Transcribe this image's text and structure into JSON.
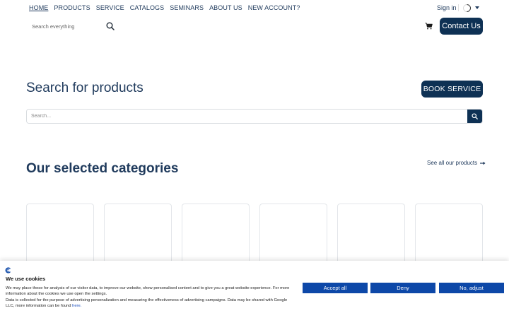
{
  "nav": {
    "items": [
      {
        "label": "HOME",
        "active": true
      },
      {
        "label": "PRODUCTS"
      },
      {
        "label": "SERVICE"
      },
      {
        "label": "CATALOGS"
      },
      {
        "label": "SEMINARS"
      },
      {
        "label": "ABOUT US"
      },
      {
        "label": "NEW ACCOUNT?"
      }
    ],
    "signin": "Sign in"
  },
  "header": {
    "search_placeholder": "Search everything",
    "contact_label": "Contact Us",
    "search_icon": "search-icon",
    "cart_icon": "cart-icon"
  },
  "search_section": {
    "heading": "Search for products",
    "book_label": "BOOK SERVICE",
    "placeholder": "Search..."
  },
  "categories": {
    "heading": "Our selected categories",
    "see_all": "See all our products"
  },
  "cookie": {
    "title": "We use cookies",
    "text_1": "We may place these for analysis of our visitor data, to improve our website, show personalised content and to give you a great website experience. For more information about the cookies we use open the settings.",
    "text_2": "Data is collected for the purpose of advertising personalization and measuring the effectiveness of advertising campaigns. Data may be shared with Google LLC, more information can be found",
    "link": "here.",
    "accept": "Accept all",
    "deny": "Deny",
    "adjust": "No, adjust"
  },
  "colors": {
    "primary": "#0e3154",
    "text": "#1f3a5c",
    "cookie_button": "#0d48a8"
  }
}
